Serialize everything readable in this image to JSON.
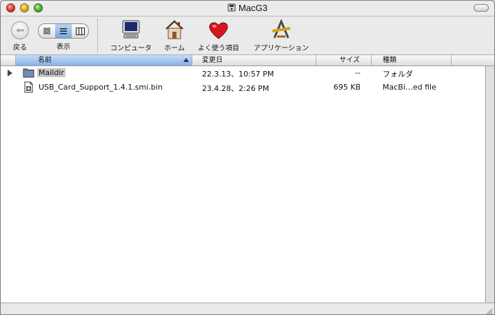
{
  "window": {
    "title": "MacG3"
  },
  "toolbar": {
    "back_label": "戻る",
    "view_label": "表示",
    "items": [
      {
        "label": "コンピュータ"
      },
      {
        "label": "ホーム"
      },
      {
        "label": "よく使う項目"
      },
      {
        "label": "アプリケーション"
      }
    ]
  },
  "columns": {
    "name": "名前",
    "date": "変更日",
    "size": "サイズ",
    "kind": "種類"
  },
  "files": [
    {
      "name": "Maildir",
      "date": "22.3.13、10:57 PM",
      "size": "--",
      "kind": "フォルダ"
    },
    {
      "name": "USB_Card_Support_1.4.1.smi.bin",
      "date": "23.4.28、2:26 PM",
      "size": "695 KB",
      "kind": "MacBi…ed file"
    }
  ]
}
